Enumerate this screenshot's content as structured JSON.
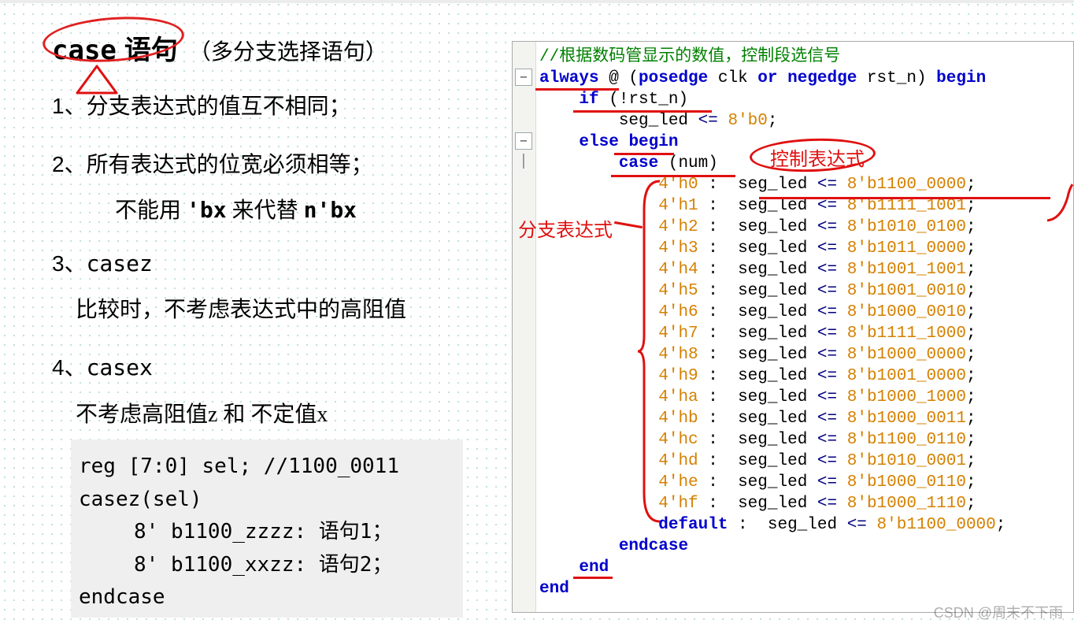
{
  "left": {
    "title_mono": "case",
    "title_cn": "语句",
    "title_sub": "（多分支选择语句）",
    "points": [
      {
        "n": "1、",
        "text": "分支表达式的值互不相同；"
      },
      {
        "n": "2、",
        "text": "所有表达式的位宽必须相等；"
      },
      {
        "n": "3、",
        "text": "casez"
      },
      {
        "n": "4、",
        "text": "casex"
      }
    ],
    "sub_2a": "不能用 ",
    "sub_2_bx": "'bx",
    "sub_2b": " 来代替 ",
    "sub_2_nbx": "n'bx",
    "note_3": "比较时，不考虑表达式中的高阻值",
    "note_4": "不考虑高阻值z 和 不定值x",
    "example": {
      "l1": "reg [7:0] sel; //1100_0011",
      "l2": "casez(sel)",
      "l3": "8' b1100_zzzz: 语句1；",
      "l4": "8' b1100_xxzz: 语句2；",
      "l5": "endcase"
    }
  },
  "right": {
    "comment": "//根据数码管显示的数值，控制段选信号",
    "always": {
      "kw1": "always",
      "at": " @ (",
      "kw2": "posedge",
      "clk": " clk ",
      "kw3": "or",
      "sp": " ",
      "kw4": "negedge",
      "rst": " rst_n) ",
      "kw5": "begin"
    },
    "if_line": {
      "kw": "if",
      "cond": " (!rst_n)"
    },
    "seg0": {
      "pre": "        seg_led ",
      "op": "<=",
      "sp": " ",
      "val": "8'b0",
      "semi": ";"
    },
    "else_line": {
      "kw1": "else",
      "sp": " ",
      "kw2": "begin"
    },
    "case_line": {
      "kw": "case",
      "arg": " (num)"
    },
    "cases": [
      {
        "k": "4'h0",
        "v": "8'b1100_0000"
      },
      {
        "k": "4'h1",
        "v": "8'b1111_1001"
      },
      {
        "k": "4'h2",
        "v": "8'b1010_0100"
      },
      {
        "k": "4'h3",
        "v": "8'b1011_0000"
      },
      {
        "k": "4'h4",
        "v": "8'b1001_1001"
      },
      {
        "k": "4'h5",
        "v": "8'b1001_0010"
      },
      {
        "k": "4'h6",
        "v": "8'b1000_0010"
      },
      {
        "k": "4'h7",
        "v": "8'b1111_1000"
      },
      {
        "k": "4'h8",
        "v": "8'b1000_0000"
      },
      {
        "k": "4'h9",
        "v": "8'b1001_0000"
      },
      {
        "k": "4'ha",
        "v": "8'b1000_1000"
      },
      {
        "k": "4'hb",
        "v": "8'b1000_0011"
      },
      {
        "k": "4'hc",
        "v": "8'b1100_0110"
      },
      {
        "k": "4'hd",
        "v": "8'b1010_0001"
      },
      {
        "k": "4'he",
        "v": "8'b1000_0110"
      },
      {
        "k": "4'hf",
        "v": "8'b1000_1110"
      }
    ],
    "default_line": {
      "kw": "default",
      "v": "8'b1100_0000"
    },
    "seg_label": "seg_led",
    "op": "<=",
    "colon": " :  ",
    "semi": ";",
    "endcase": "endcase",
    "end1": "end",
    "end2": "end",
    "anno_control": "控制表达式",
    "anno_branch": "分支表达式"
  },
  "watermark": "CSDN @周末不下雨"
}
